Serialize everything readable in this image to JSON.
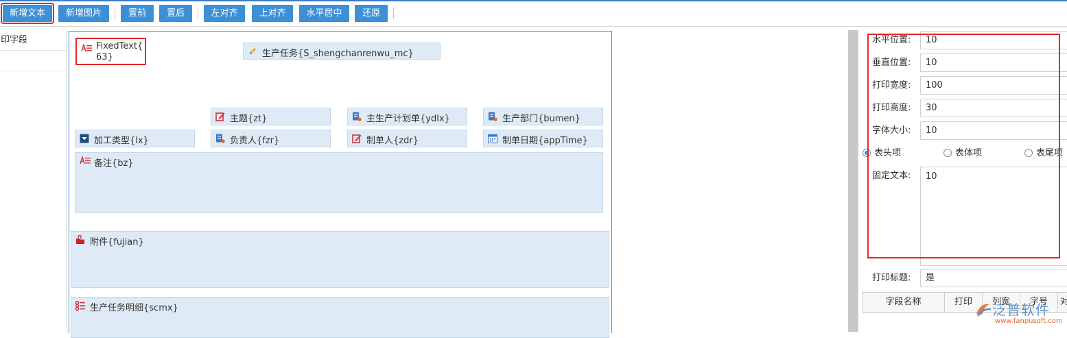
{
  "toolbar": {
    "buttons": [
      "新增文本",
      "新增图片",
      "置前",
      "置后",
      "左对齐",
      "上对齐",
      "水平居中",
      "还原"
    ]
  },
  "field_list": {
    "header": "打印字段",
    "row1": "}"
  },
  "canvas": {
    "fixed_text_line1": "FixedText{",
    "fixed_text_line2": "63}",
    "fields": {
      "task": "生产任务{S_shengchanrenwu_mc}",
      "subject": "主题{zt}",
      "plan": "主生产计划单{ydlx}",
      "dept": "生产部门{bumen}",
      "process_type": "加工类型{lx}",
      "owner": "负责人{fzr}",
      "creator": "制单人{zdr}",
      "date": "制单日期{appTime}",
      "note": "备注{bz}",
      "attachment": "附件{fujian}",
      "detail": "生产任务明细{scmx}"
    }
  },
  "properties": {
    "h_pos_label": "水平位置:",
    "h_pos_value": "10",
    "v_pos_label": "垂直位置:",
    "v_pos_value": "10",
    "width_label": "打印宽度:",
    "width_value": "100",
    "height_label": "打印高度:",
    "height_value": "30",
    "font_label": "字体大小:",
    "font_value": "10",
    "radio_header": "表头项",
    "radio_body": "表体项",
    "radio_footer": "表尾项",
    "fixed_text_label": "固定文本:",
    "fixed_text_value": "10",
    "print_title_label": "打印标题:",
    "print_title_value": "是",
    "grid_headers": [
      "字段名称",
      "打印",
      "列宽",
      "字号",
      "对"
    ]
  },
  "watermark": {
    "brand": "泛普软件",
    "url": "www.fanpusoft.com"
  },
  "colors": {
    "accent": "#3d8fd6",
    "highlight": "#e5262b",
    "field_bg": "#deebf7"
  }
}
